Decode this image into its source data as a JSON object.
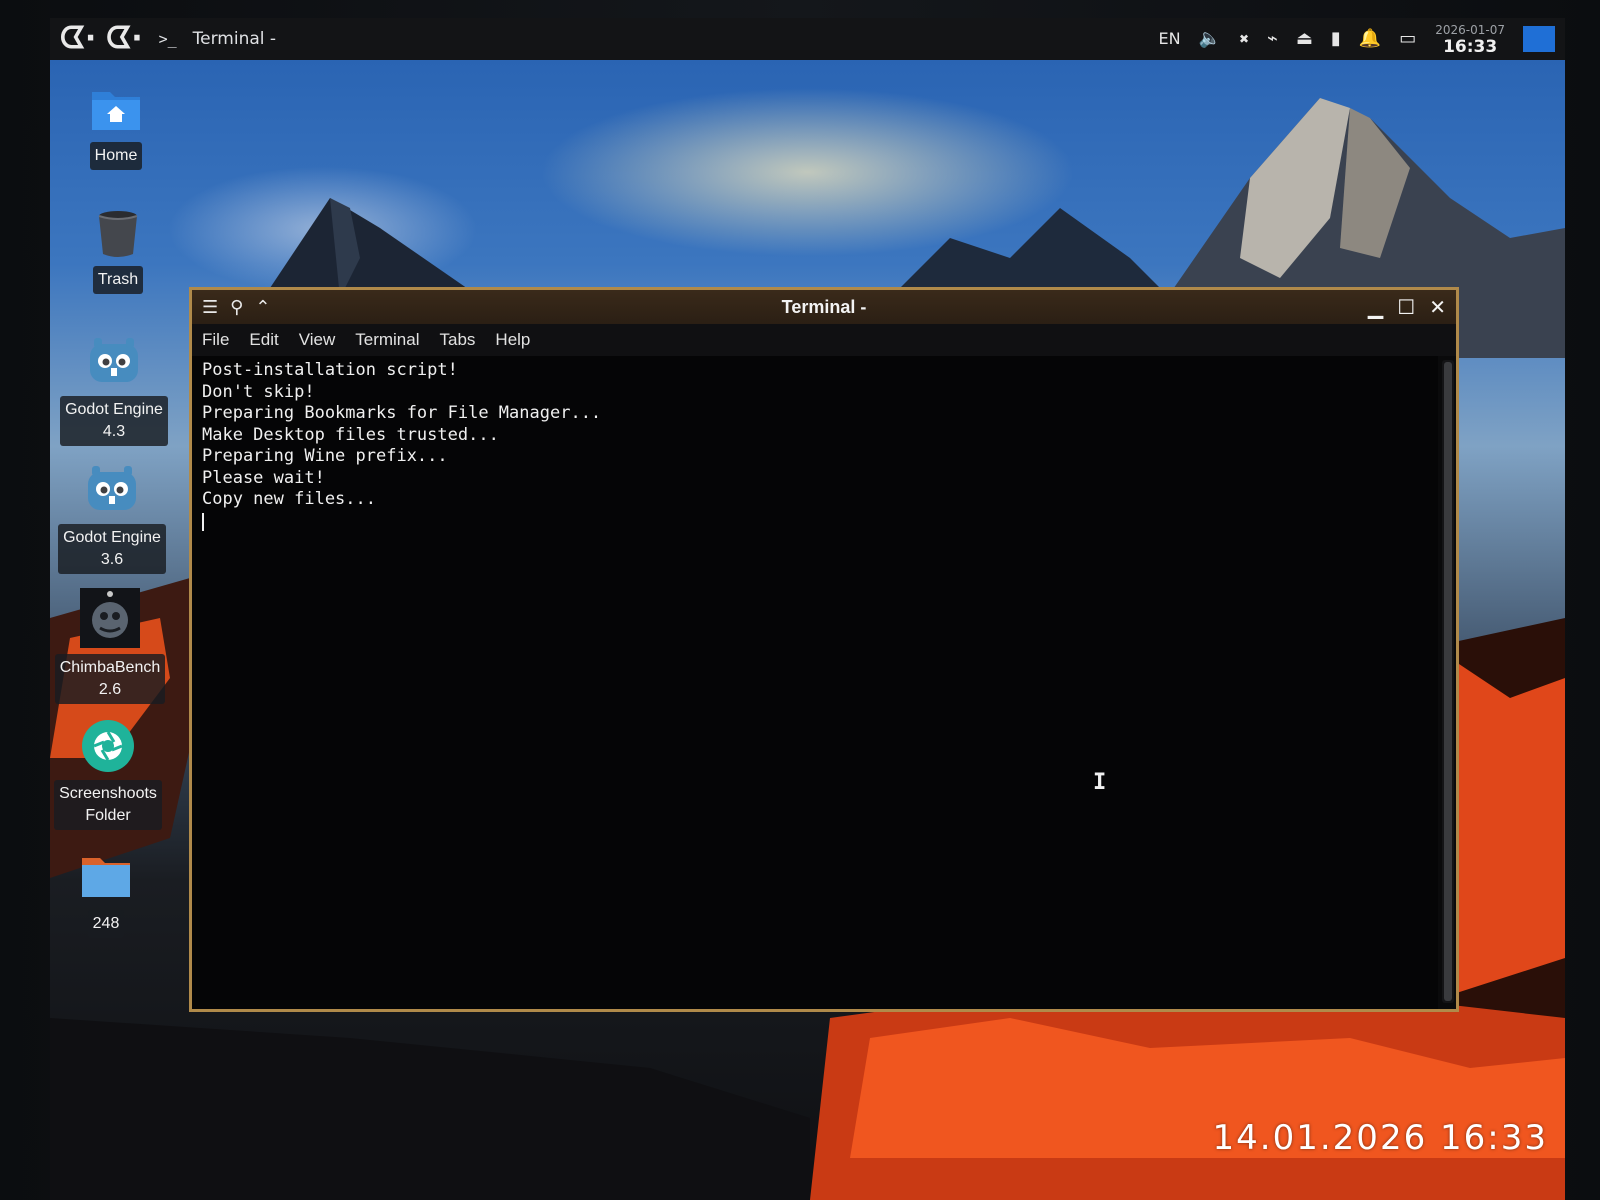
{
  "topbar": {
    "task_title": "Terminal -",
    "prompt_glyph": ">_",
    "language": "EN",
    "volume_icon": "speaker-icon",
    "date": "2026-01-07",
    "time": "16:33"
  },
  "desktop_icons": [
    {
      "label": "Home",
      "icon": "home-folder-icon"
    },
    {
      "label": "Trash",
      "icon": "trash-icon"
    },
    {
      "label": "Godot Engine\n4.3",
      "icon": "godot-icon"
    },
    {
      "label": "Godot Engine\n3.6",
      "icon": "godot-icon"
    },
    {
      "label": "ChimbaBench\n2.6",
      "icon": "chimbabench-icon"
    },
    {
      "label": "Screenshoots\nFolder",
      "icon": "shutter-icon"
    },
    {
      "label": "248",
      "icon": "folder-icon"
    }
  ],
  "terminal": {
    "title": "Terminal -",
    "menu": [
      "File",
      "Edit",
      "View",
      "Terminal",
      "Tabs",
      "Help"
    ],
    "lines": [
      "Post-installation script!",
      "Don't skip!",
      "Preparing Bookmarks for File Manager...",
      "Make Desktop files trusted...",
      "Preparing Wine prefix...",
      "Please wait!",
      "Copy new files..."
    ]
  },
  "photo_timestamp": "14.01.2026 16:33",
  "colors": {
    "panel_bg": "#131416",
    "window_border": "#b08a4a",
    "titlebar_bg": "#2b1f14",
    "terminal_bg": "#050506",
    "terminal_fg": "#f0f0f0",
    "show_desktop_blue": "#1f6fd6",
    "godot_blue": "#478cbf",
    "shutter_teal": "#1fb39a"
  }
}
